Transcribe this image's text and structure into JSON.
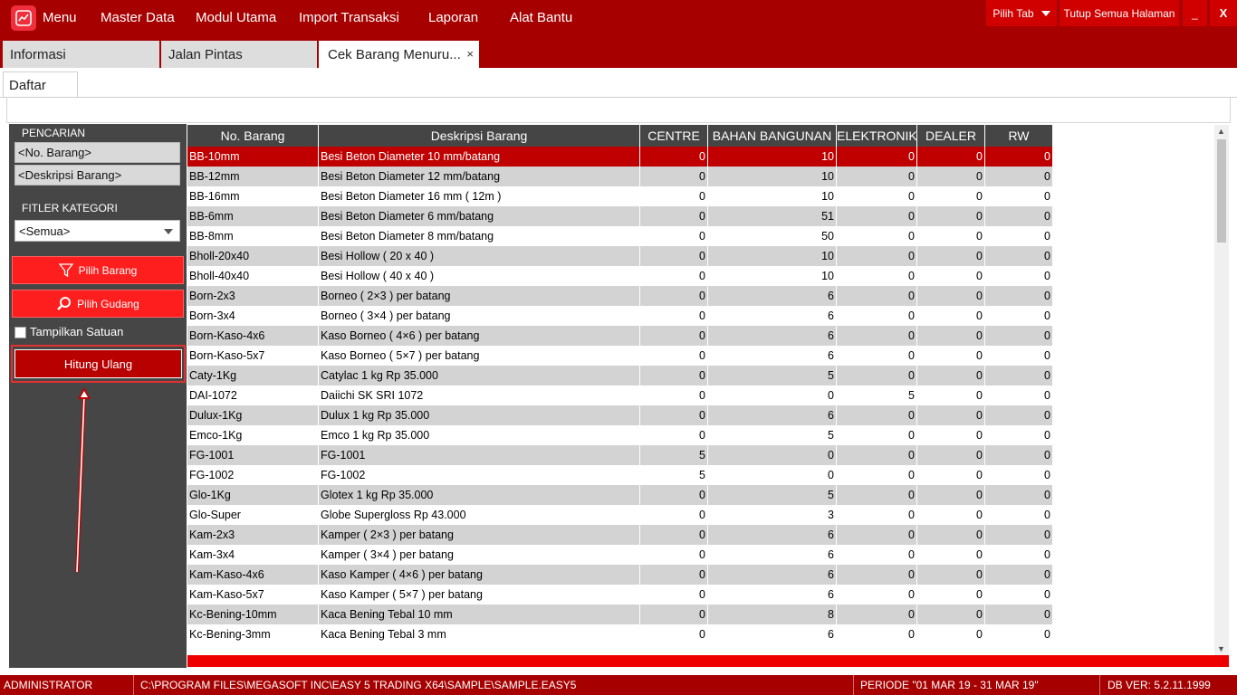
{
  "menubar": {
    "items": [
      "Menu",
      "Master Data",
      "Modul Utama",
      "Import Transaksi",
      "Laporan",
      "Alat Bantu"
    ],
    "pilih_tab": "Pilih Tab",
    "tutup_semua": "Tutup Semua Halaman",
    "minimize": "_",
    "close": "X"
  },
  "tabs": [
    {
      "label": "Informasi"
    },
    {
      "label": "Jalan Pintas"
    },
    {
      "label": "Cek Barang Menuru..."
    }
  ],
  "tab_close_glyph": "×",
  "subtab": "Daftar",
  "left": {
    "pencarian_label": "PENCARIAN",
    "no_barang_field": "<No. Barang>",
    "deskripsi_field": "<Deskripsi Barang>",
    "filter_label": "FITLER KATEGORI",
    "kategori_value": "<Semua>",
    "pilih_barang": "Pilih Barang",
    "pilih_gudang": "Pilih Gudang",
    "tampilkan_satuan": "Tampilkan Satuan",
    "hitung_ulang": "Hitung Ulang"
  },
  "grid": {
    "columns": [
      "No. Barang",
      "Deskripsi Barang",
      "CENTRE",
      "BAHAN BANGUNAN",
      "ELEKTRONIK",
      "DEALER",
      "RW"
    ],
    "rows": [
      [
        "BB-10mm",
        "Besi Beton Diameter 10 mm/batang",
        "0",
        "10",
        "0",
        "0",
        "0"
      ],
      [
        "BB-12mm",
        "Besi Beton Diameter 12 mm/batang",
        "0",
        "10",
        "0",
        "0",
        "0"
      ],
      [
        "BB-16mm",
        "Besi Beton Diameter 16 mm ( 12m )",
        "0",
        "10",
        "0",
        "0",
        "0"
      ],
      [
        "BB-6mm",
        "Besi Beton Diameter 6 mm/batang",
        "0",
        "51",
        "0",
        "0",
        "0"
      ],
      [
        "BB-8mm",
        "Besi Beton Diameter 8 mm/batang",
        "0",
        "50",
        "0",
        "0",
        "0"
      ],
      [
        "Bholl-20x40",
        "Besi Hollow ( 20 x 40 )",
        "0",
        "10",
        "0",
        "0",
        "0"
      ],
      [
        "Bholl-40x40",
        "Besi Hollow ( 40 x 40 )",
        "0",
        "10",
        "0",
        "0",
        "0"
      ],
      [
        "Born-2x3",
        "Borneo ( 2×3 ) per batang",
        "0",
        "6",
        "0",
        "0",
        "0"
      ],
      [
        "Born-3x4",
        "Borneo ( 3×4 ) per batang",
        "0",
        "6",
        "0",
        "0",
        "0"
      ],
      [
        "Born-Kaso-4x6",
        "Kaso Borneo ( 4×6 ) per batang",
        "0",
        "6",
        "0",
        "0",
        "0"
      ],
      [
        "Born-Kaso-5x7",
        "Kaso Borneo ( 5×7 ) per batang",
        "0",
        "6",
        "0",
        "0",
        "0"
      ],
      [
        "Caty-1Kg",
        "Catylac 1 kg Rp 35.000",
        "0",
        "5",
        "0",
        "0",
        "0"
      ],
      [
        "DAI-1072",
        "Daiichi SK SRI 1072",
        "0",
        "0",
        "5",
        "0",
        "0"
      ],
      [
        "Dulux-1Kg",
        "Dulux 1 kg Rp 35.000",
        "0",
        "6",
        "0",
        "0",
        "0"
      ],
      [
        "Emco-1Kg",
        "Emco 1 kg Rp 35.000",
        "0",
        "5",
        "0",
        "0",
        "0"
      ],
      [
        "FG-1001",
        "FG-1001",
        "5",
        "0",
        "0",
        "0",
        "0"
      ],
      [
        "FG-1002",
        "FG-1002",
        "5",
        "0",
        "0",
        "0",
        "0"
      ],
      [
        "Glo-1Kg",
        "Glotex 1 kg Rp 35.000",
        "0",
        "5",
        "0",
        "0",
        "0"
      ],
      [
        "Glo-Super",
        "Globe Supergloss Rp 43.000",
        "0",
        "3",
        "0",
        "0",
        "0"
      ],
      [
        "Kam-2x3",
        "Kamper ( 2×3 ) per batang",
        "0",
        "6",
        "0",
        "0",
        "0"
      ],
      [
        "Kam-3x4",
        "Kamper ( 3×4 ) per batang",
        "0",
        "6",
        "0",
        "0",
        "0"
      ],
      [
        "Kam-Kaso-4x6",
        "Kaso Kamper ( 4×6 ) per batang",
        "0",
        "6",
        "0",
        "0",
        "0"
      ],
      [
        "Kam-Kaso-5x7",
        "Kaso Kamper ( 5×7 ) per batang",
        "0",
        "6",
        "0",
        "0",
        "0"
      ],
      [
        "Kc-Bening-10mm",
        "Kaca Bening Tebal 10 mm",
        "0",
        "8",
        "0",
        "0",
        "0"
      ],
      [
        "Kc-Bening-3mm",
        "Kaca Bening Tebal 3 mm",
        "0",
        "6",
        "0",
        "0",
        "0"
      ]
    ],
    "selected_row": 0
  },
  "status": {
    "user": "ADMINISTRATOR",
    "path": "C:\\PROGRAM FILES\\MEGASOFT INC\\EASY 5 TRADING X64\\SAMPLE\\SAMPLE.EASY5",
    "periode": "PERIODE \"01 MAR 19 - 31 MAR 19\"",
    "dbver": "DB VER: 5.2.11.1999"
  },
  "colors": {
    "brand": "#a60000",
    "button": "#ff1e1e",
    "selected_row": "#c00000"
  }
}
